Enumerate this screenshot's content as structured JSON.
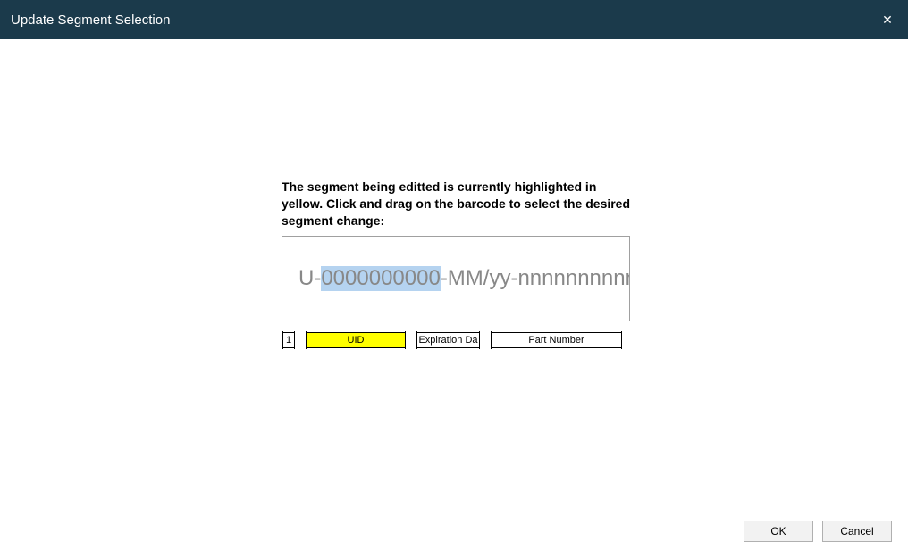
{
  "window": {
    "title": "Update Segment Selection",
    "close_glyph": "✕"
  },
  "instructions": "The segment being editted is currently highlighted in yellow. Click and drag on the barcode to select the desired segment change:",
  "barcode": {
    "prefix": "U-",
    "highlighted": "0000000000",
    "suffix": "-MM/yy-nnnnnnnnnnnn"
  },
  "segments": {
    "one": "1",
    "uid": "UID",
    "expiration": "Expiration Da",
    "part_number": "Part Number"
  },
  "selected_segment": "uid",
  "buttons": {
    "ok": "OK",
    "cancel": "Cancel"
  }
}
